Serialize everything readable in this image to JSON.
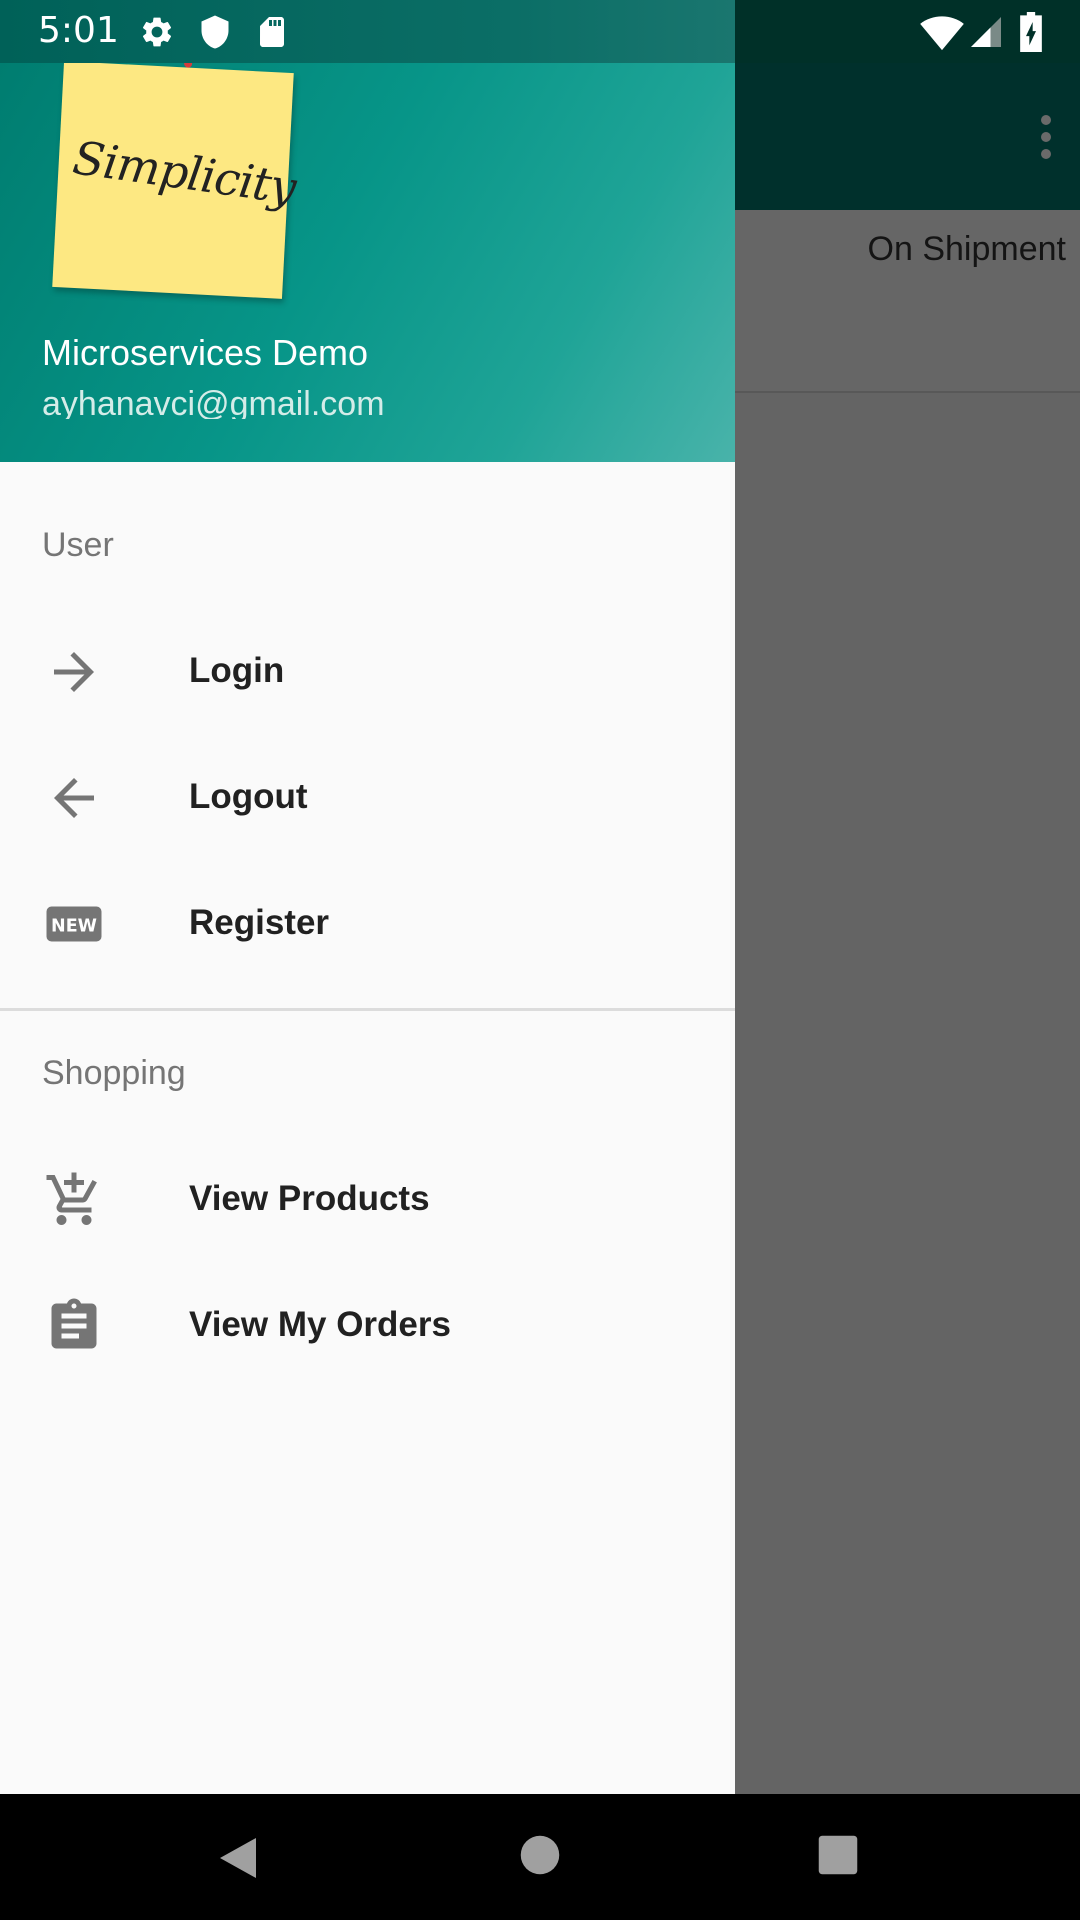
{
  "status_bar": {
    "time": "5:01",
    "icons_left": [
      "gear-icon",
      "shield-icon",
      "sd-card-icon"
    ],
    "icons_right": [
      "wifi-icon",
      "signal-icon",
      "battery-charging-icon"
    ]
  },
  "background_screen": {
    "order_status": "On Shipment",
    "overflow_icon": "more-vert-icon"
  },
  "drawer": {
    "header": {
      "logo_text": "Simplicity",
      "name": "Microservices Demo",
      "email": "ayhanavci@gmail.com"
    },
    "sections": [
      {
        "title": "User",
        "items": [
          {
            "label": "Login",
            "icon": "arrow-forward-icon"
          },
          {
            "label": "Logout",
            "icon": "arrow-back-icon"
          },
          {
            "label": "Register",
            "icon": "new-badge-icon"
          }
        ]
      },
      {
        "title": "Shopping",
        "items": [
          {
            "label": "View Products",
            "icon": "add-shopping-cart-icon"
          },
          {
            "label": "View My Orders",
            "icon": "clipboard-icon"
          }
        ]
      }
    ]
  },
  "nav_bar": {
    "buttons": [
      "back-icon",
      "home-icon",
      "recents-icon"
    ]
  },
  "colors": {
    "header_gradient_start": "#007d70",
    "header_gradient_end": "#49b3aa",
    "drawer_bg": "#fafafa",
    "scrim": "#646464",
    "icon_gray": "#757575"
  }
}
